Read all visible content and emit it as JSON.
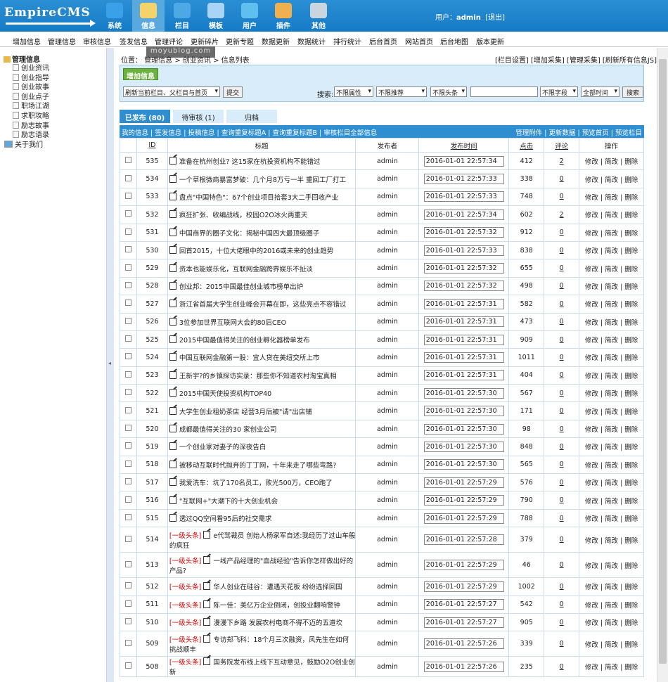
{
  "app": {
    "logo": "EmpireCMS"
  },
  "topnav": [
    {
      "label": "系统",
      "icon": "globe-icon",
      "color": "#3aa0e8"
    },
    {
      "label": "信息",
      "icon": "document-edit-icon",
      "color": "#f5d36b"
    },
    {
      "label": "栏目",
      "icon": "folder-icon",
      "color": "#4fa8e6"
    },
    {
      "label": "模板",
      "icon": "template-window-icon",
      "color": "#a9d4f5"
    },
    {
      "label": "用户",
      "icon": "user-icon",
      "color": "#5fc0ef"
    },
    {
      "label": "插件",
      "icon": "tools-icon",
      "color": "#f0b050"
    },
    {
      "label": "其他",
      "icon": "gear-icon",
      "color": "#c9d6e0"
    }
  ],
  "user": {
    "prefix": "用户：",
    "name": "admin",
    "logout": "[退出]"
  },
  "menu": [
    "增加信息",
    "管理信息",
    "审核信息",
    "签发信息",
    "管理评论",
    "更新碎片",
    "更新专题",
    "数据更新",
    "数据统计",
    "排行统计",
    "后台首页",
    "网站首页",
    "后台地图",
    "版本更新"
  ],
  "tree": {
    "root": "管理信息",
    "items": [
      "创业资讯",
      "创业指导",
      "创业故事",
      "创业点子",
      "职场江湖",
      "求职攻略",
      "励志故事",
      "励志语录",
      "关于我们"
    ]
  },
  "watermark": "moyublog.com",
  "location": {
    "text": "位置：  管理信息 > 创业资讯 > 信息列表"
  },
  "toplinks": "[栏目设置] [增加采集] [管理采集] [刷新所有信息JS]",
  "add_button": "增加信息",
  "refresh_select": "刷新当前栏目、父栏目与首页",
  "submit": "提交",
  "search": {
    "label": "搜索:",
    "selects": [
      "不限属性",
      "不限推荐",
      "不限头条",
      "不限字段",
      "全部时间"
    ],
    "button": "搜索"
  },
  "tabs": [
    "已发布 (80)",
    "待审核 (1)",
    "归档"
  ],
  "subbar": {
    "left": "我的信息 | 签发信息 | 投稿信息 | 查询重复标题A | 查询重复标题B | 审核栏目全部信息",
    "right": "管理附件 | 更新数据 | 预览首页 | 预览栏目"
  },
  "table": {
    "headers": {
      "id": "ID",
      "title": "标题",
      "publisher": "发布者",
      "time": "发布时间",
      "hits": "点击",
      "comments": "评论",
      "ops": "操作"
    },
    "ops": "修改 | 简改 | 删除",
    "rows": [
      {
        "id": "535",
        "head": "",
        "title": "准备在杭州创业? 这15家在杭投资机构不能错过",
        "pub": "admin",
        "time": "2016-01-01 22:57:34",
        "hits": "412",
        "com": "2"
      },
      {
        "id": "534",
        "head": "",
        "title": "一个草根微商暴富梦破：几个月8万亏一半 重回工厂打工",
        "pub": "admin",
        "time": "2016-01-01 22:57:33",
        "hits": "338",
        "com": "0"
      },
      {
        "id": "533",
        "head": "",
        "title": "盘点\"中国特色\"：67个创业项目拾套3大二手回收产业",
        "pub": "admin",
        "time": "2016-01-01 22:57:33",
        "hits": "748",
        "com": "0"
      },
      {
        "id": "532",
        "head": "",
        "title": "疯狂扩张、收编战线，校园O2O冰火两重天",
        "pub": "admin",
        "time": "2016-01-01 22:57:34",
        "hits": "602",
        "com": "2"
      },
      {
        "id": "531",
        "head": "",
        "title": "中国商界的圈子文化：揭秘中国四大最顶级圈子",
        "pub": "admin",
        "time": "2016-01-01 22:57:32",
        "hits": "912",
        "com": "0"
      },
      {
        "id": "530",
        "head": "",
        "title": "回首2015，十位大佬眼中的2016或未来的创业趋势",
        "pub": "admin",
        "time": "2016-01-01 22:57:33",
        "hits": "838",
        "com": "0"
      },
      {
        "id": "529",
        "head": "",
        "title": "资本也能娱乐化，互联网金融跨界娱乐不扯淡",
        "pub": "admin",
        "time": "2016-01-01 22:57:32",
        "hits": "655",
        "com": "0"
      },
      {
        "id": "528",
        "head": "",
        "title": "创业邦：2015中国最佳创业城市榜单出炉",
        "pub": "admin",
        "time": "2016-01-01 22:57:32",
        "hits": "498",
        "com": "0"
      },
      {
        "id": "527",
        "head": "",
        "title": "浙江省首届大学生创业峰会开幕在即，这些亮点不容错过",
        "pub": "admin",
        "time": "2016-01-01 22:57:31",
        "hits": "582",
        "com": "0"
      },
      {
        "id": "526",
        "head": "",
        "title": "3位参加世界互联网大会的80后CEO",
        "pub": "admin",
        "time": "2016-01-01 22:57:31",
        "hits": "473",
        "com": "0"
      },
      {
        "id": "525",
        "head": "",
        "title": "2015中国最值得关注的创业孵化器榜单发布",
        "pub": "admin",
        "time": "2016-01-01 22:57:31",
        "hits": "909",
        "com": "0"
      },
      {
        "id": "524",
        "head": "",
        "title": "中国互联网金融第一股：宜人贷在美纽交所上市",
        "pub": "admin",
        "time": "2016-01-01 22:57:31",
        "hits": "1011",
        "com": "0"
      },
      {
        "id": "523",
        "head": "",
        "title": "王新宇?的乡镇探访实录：那些你不知道农村淘宝真相",
        "pub": "admin",
        "time": "2016-01-01 22:57:31",
        "hits": "404",
        "com": "0"
      },
      {
        "id": "522",
        "head": "",
        "title": "2015中国天使投资机构TOP40",
        "pub": "admin",
        "time": "2016-01-01 22:57:30",
        "hits": "567",
        "com": "0"
      },
      {
        "id": "521",
        "head": "",
        "title": "大学生创业租奶茶店 经营3月后被\"请\"出店铺",
        "pub": "admin",
        "time": "2016-01-01 22:57:30",
        "hits": "171",
        "com": "0"
      },
      {
        "id": "520",
        "head": "",
        "title": "成都最值得关注的30 家创业公司",
        "pub": "admin",
        "time": "2016-01-01 22:57:30",
        "hits": "98",
        "com": "0"
      },
      {
        "id": "519",
        "head": "",
        "title": "一个创业家对妻子的深夜告白",
        "pub": "admin",
        "time": "2016-01-01 22:57:30",
        "hits": "848",
        "com": "0"
      },
      {
        "id": "518",
        "head": "",
        "title": "被移动互联时代抛弃的丁丁网，十年来走了哪些弯路?",
        "pub": "admin",
        "time": "2016-01-01 22:57:30",
        "hits": "565",
        "com": "0"
      },
      {
        "id": "517",
        "head": "",
        "title": "我爱洗车：坑了170名员工，败光500万，CEO跑了",
        "pub": "admin",
        "time": "2016-01-01 22:57:29",
        "hits": "576",
        "com": "0"
      },
      {
        "id": "516",
        "head": "",
        "title": "\"互联网+\"大潮下的十大创业机会",
        "pub": "admin",
        "time": "2016-01-01 22:57:29",
        "hits": "790",
        "com": "0"
      },
      {
        "id": "515",
        "head": "",
        "title": "透过QQ空间看95后的社交需求",
        "pub": "admin",
        "time": "2016-01-01 22:57:29",
        "hits": "788",
        "com": "0"
      },
      {
        "id": "514",
        "head": "[一级头条]",
        "title": "e代驾裁员 创始人杨家军自述:我经历了过山车般的疯狂",
        "pub": "admin",
        "time": "2016-01-01 22:57:28",
        "hits": "379",
        "com": "0"
      },
      {
        "id": "513",
        "head": "[一级头条]",
        "title": "一线产品经理的\"血战经验\"告诉你怎样做出好的产品?",
        "pub": "admin",
        "time": "2016-01-01 22:57:29",
        "hits": "46",
        "com": "0"
      },
      {
        "id": "512",
        "head": "[一级头条]",
        "title": "华人创业在硅谷：遭遇天花板 纷纷选择回国",
        "pub": "admin",
        "time": "2016-01-01 22:57:29",
        "hits": "1002",
        "com": "0"
      },
      {
        "id": "511",
        "head": "[一级头条]",
        "title": "陈一佳：美亿万企业倒闭，创投业翻响警钟",
        "pub": "admin",
        "time": "2016-01-01 22:57:27",
        "hits": "542",
        "com": "0"
      },
      {
        "id": "510",
        "head": "[一级头条]",
        "title": "漫漫下乡路 发展农村电商不得不迈的五道坎",
        "pub": "admin",
        "time": "2016-01-01 22:57:27",
        "hits": "905",
        "com": "0"
      },
      {
        "id": "509",
        "head": "[一级头条]",
        "title": "专访郑飞科：18个月三次融资，风先生在如何挑战顺丰",
        "pub": "admin",
        "time": "2016-01-01 22:57:26",
        "hits": "339",
        "com": "0"
      },
      {
        "id": "508",
        "head": "[一级头条]",
        "title": "国务院发布线上线下互动意见，鼓励O2O创业创新",
        "pub": "admin",
        "time": "2016-01-01 22:57:26",
        "hits": "235",
        "com": "0"
      }
    ]
  }
}
